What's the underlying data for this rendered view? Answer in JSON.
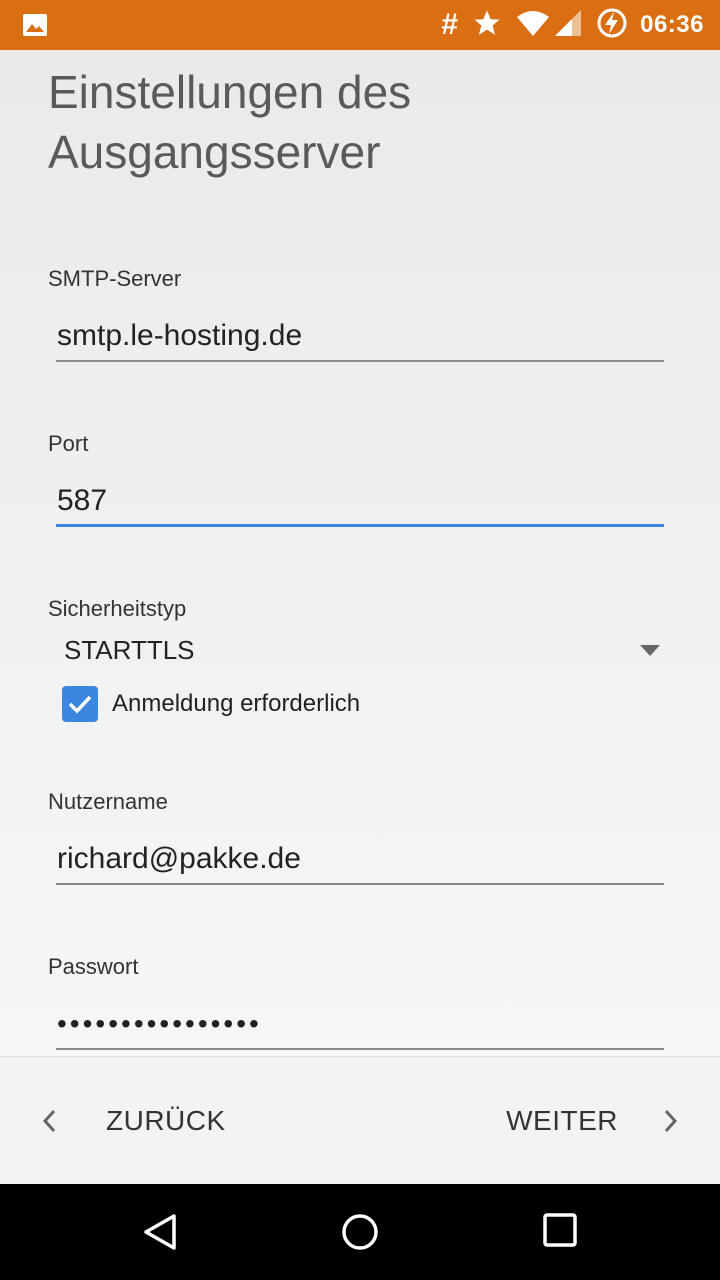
{
  "status_bar": {
    "icons": [
      "image-icon",
      "hash-icon",
      "star-icon",
      "wifi-icon",
      "signal-icon",
      "battery-charging-icon"
    ],
    "hash_glyph": "#",
    "time": "06:36",
    "color": "#d96f12"
  },
  "page": {
    "title": "Einstellungen des Ausgangsserver"
  },
  "form": {
    "smtp_server": {
      "label": "SMTP-Server",
      "value": "smtp.le-hosting.de"
    },
    "port": {
      "label": "Port",
      "value": "587"
    },
    "security": {
      "label": "Sicherheitstyp",
      "value": "STARTTLS"
    },
    "auth_required": {
      "label": "Anmeldung erforderlich",
      "checked": true
    },
    "username": {
      "label": "Nutzername",
      "value": "richard@pakke.de"
    },
    "password": {
      "label": "Passwort",
      "value": "••••••••••••••••"
    }
  },
  "navigation": {
    "back_label": "ZURÜCK",
    "next_label": "WEITER"
  },
  "colors": {
    "accent": "#3d86e0",
    "status_bar": "#d96f12"
  }
}
